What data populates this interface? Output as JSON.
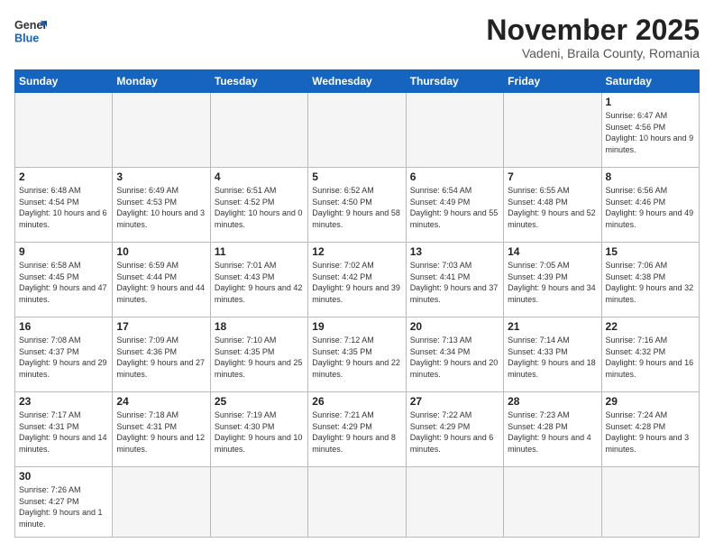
{
  "logo": {
    "line1": "General",
    "line2": "Blue"
  },
  "title": "November 2025",
  "location": "Vadeni, Braila County, Romania",
  "days_header": [
    "Sunday",
    "Monday",
    "Tuesday",
    "Wednesday",
    "Thursday",
    "Friday",
    "Saturday"
  ],
  "weeks": [
    [
      {
        "num": "",
        "info": ""
      },
      {
        "num": "",
        "info": ""
      },
      {
        "num": "",
        "info": ""
      },
      {
        "num": "",
        "info": ""
      },
      {
        "num": "",
        "info": ""
      },
      {
        "num": "",
        "info": ""
      },
      {
        "num": "1",
        "info": "Sunrise: 6:47 AM\nSunset: 4:56 PM\nDaylight: 10 hours and 9 minutes."
      }
    ],
    [
      {
        "num": "2",
        "info": "Sunrise: 6:48 AM\nSunset: 4:54 PM\nDaylight: 10 hours and 6 minutes."
      },
      {
        "num": "3",
        "info": "Sunrise: 6:49 AM\nSunset: 4:53 PM\nDaylight: 10 hours and 3 minutes."
      },
      {
        "num": "4",
        "info": "Sunrise: 6:51 AM\nSunset: 4:52 PM\nDaylight: 10 hours and 0 minutes."
      },
      {
        "num": "5",
        "info": "Sunrise: 6:52 AM\nSunset: 4:50 PM\nDaylight: 9 hours and 58 minutes."
      },
      {
        "num": "6",
        "info": "Sunrise: 6:54 AM\nSunset: 4:49 PM\nDaylight: 9 hours and 55 minutes."
      },
      {
        "num": "7",
        "info": "Sunrise: 6:55 AM\nSunset: 4:48 PM\nDaylight: 9 hours and 52 minutes."
      },
      {
        "num": "8",
        "info": "Sunrise: 6:56 AM\nSunset: 4:46 PM\nDaylight: 9 hours and 49 minutes."
      }
    ],
    [
      {
        "num": "9",
        "info": "Sunrise: 6:58 AM\nSunset: 4:45 PM\nDaylight: 9 hours and 47 minutes."
      },
      {
        "num": "10",
        "info": "Sunrise: 6:59 AM\nSunset: 4:44 PM\nDaylight: 9 hours and 44 minutes."
      },
      {
        "num": "11",
        "info": "Sunrise: 7:01 AM\nSunset: 4:43 PM\nDaylight: 9 hours and 42 minutes."
      },
      {
        "num": "12",
        "info": "Sunrise: 7:02 AM\nSunset: 4:42 PM\nDaylight: 9 hours and 39 minutes."
      },
      {
        "num": "13",
        "info": "Sunrise: 7:03 AM\nSunset: 4:41 PM\nDaylight: 9 hours and 37 minutes."
      },
      {
        "num": "14",
        "info": "Sunrise: 7:05 AM\nSunset: 4:39 PM\nDaylight: 9 hours and 34 minutes."
      },
      {
        "num": "15",
        "info": "Sunrise: 7:06 AM\nSunset: 4:38 PM\nDaylight: 9 hours and 32 minutes."
      }
    ],
    [
      {
        "num": "16",
        "info": "Sunrise: 7:08 AM\nSunset: 4:37 PM\nDaylight: 9 hours and 29 minutes."
      },
      {
        "num": "17",
        "info": "Sunrise: 7:09 AM\nSunset: 4:36 PM\nDaylight: 9 hours and 27 minutes."
      },
      {
        "num": "18",
        "info": "Sunrise: 7:10 AM\nSunset: 4:35 PM\nDaylight: 9 hours and 25 minutes."
      },
      {
        "num": "19",
        "info": "Sunrise: 7:12 AM\nSunset: 4:35 PM\nDaylight: 9 hours and 22 minutes."
      },
      {
        "num": "20",
        "info": "Sunrise: 7:13 AM\nSunset: 4:34 PM\nDaylight: 9 hours and 20 minutes."
      },
      {
        "num": "21",
        "info": "Sunrise: 7:14 AM\nSunset: 4:33 PM\nDaylight: 9 hours and 18 minutes."
      },
      {
        "num": "22",
        "info": "Sunrise: 7:16 AM\nSunset: 4:32 PM\nDaylight: 9 hours and 16 minutes."
      }
    ],
    [
      {
        "num": "23",
        "info": "Sunrise: 7:17 AM\nSunset: 4:31 PM\nDaylight: 9 hours and 14 minutes."
      },
      {
        "num": "24",
        "info": "Sunrise: 7:18 AM\nSunset: 4:31 PM\nDaylight: 9 hours and 12 minutes."
      },
      {
        "num": "25",
        "info": "Sunrise: 7:19 AM\nSunset: 4:30 PM\nDaylight: 9 hours and 10 minutes."
      },
      {
        "num": "26",
        "info": "Sunrise: 7:21 AM\nSunset: 4:29 PM\nDaylight: 9 hours and 8 minutes."
      },
      {
        "num": "27",
        "info": "Sunrise: 7:22 AM\nSunset: 4:29 PM\nDaylight: 9 hours and 6 minutes."
      },
      {
        "num": "28",
        "info": "Sunrise: 7:23 AM\nSunset: 4:28 PM\nDaylight: 9 hours and 4 minutes."
      },
      {
        "num": "29",
        "info": "Sunrise: 7:24 AM\nSunset: 4:28 PM\nDaylight: 9 hours and 3 minutes."
      }
    ],
    [
      {
        "num": "30",
        "info": "Sunrise: 7:26 AM\nSunset: 4:27 PM\nDaylight: 9 hours and 1 minute."
      },
      {
        "num": "",
        "info": ""
      },
      {
        "num": "",
        "info": ""
      },
      {
        "num": "",
        "info": ""
      },
      {
        "num": "",
        "info": ""
      },
      {
        "num": "",
        "info": ""
      },
      {
        "num": "",
        "info": ""
      }
    ]
  ]
}
